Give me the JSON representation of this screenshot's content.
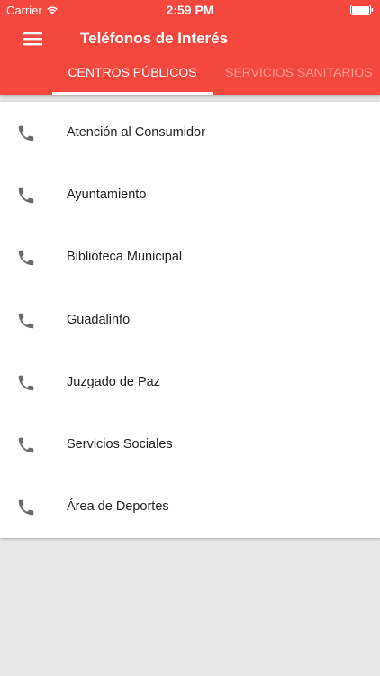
{
  "status_bar": {
    "carrier": "Carrier",
    "time": "2:59 PM"
  },
  "toolbar": {
    "title": "Teléfonos de Interés",
    "menu_icon": "hamburger-menu-icon"
  },
  "tabs": [
    {
      "label": "CENTROS PÚBLICOS",
      "active": true
    },
    {
      "label": "SERVICIOS SANITARIOS",
      "active": false
    }
  ],
  "contacts": [
    {
      "label": "Atención al Consumidor",
      "icon": "phone-icon"
    },
    {
      "label": "Ayuntamiento",
      "icon": "phone-icon"
    },
    {
      "label": "Biblioteca Municipal",
      "icon": "phone-icon"
    },
    {
      "label": "Guadalinfo",
      "icon": "phone-icon"
    },
    {
      "label": "Juzgado de Paz",
      "icon": "phone-icon"
    },
    {
      "label": "Servicios Sociales",
      "icon": "phone-icon"
    },
    {
      "label": "Área de Deportes",
      "icon": "phone-icon"
    }
  ],
  "colors": {
    "primary": "#f4473d",
    "inactive_tab": "#fb9b94",
    "icon": "#6b6b6b",
    "background": "#e8e8e8"
  }
}
